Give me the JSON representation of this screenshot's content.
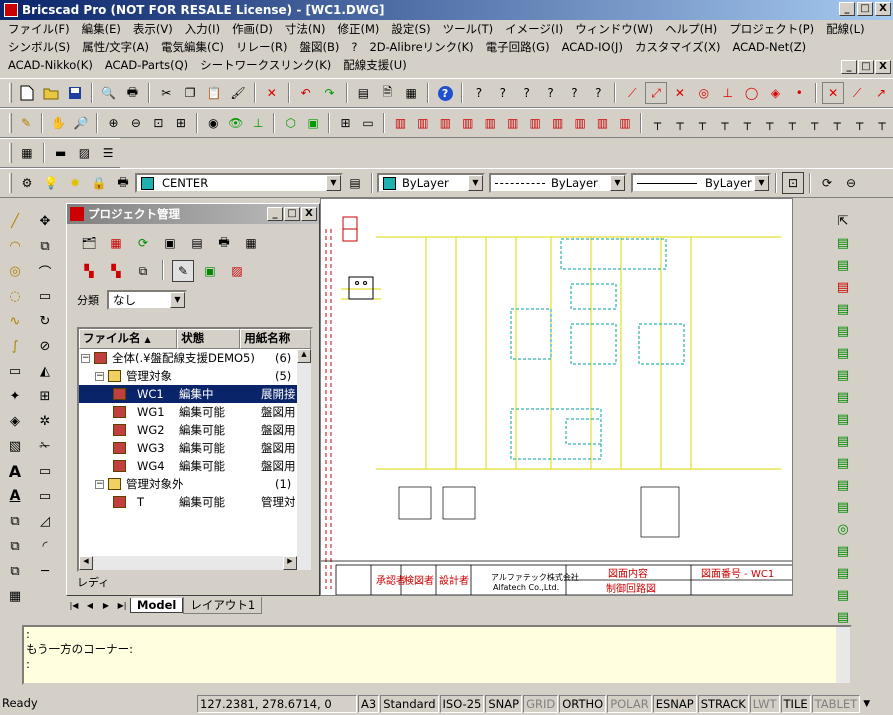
{
  "window": {
    "title": "Bricscad Pro (NOT FOR RESALE License) - [WC1.DWG]",
    "controls": [
      "_",
      "□",
      "X"
    ]
  },
  "menus": {
    "row1": [
      "ファイル(F)",
      "編集(E)",
      "表示(V)",
      "入力(I)",
      "作画(D)",
      "寸法(N)",
      "修正(M)",
      "設定(S)",
      "ツール(T)",
      "イメージ(I)",
      "ウィンドウ(W)",
      "ヘルプ(H)",
      "プロジェクト(P)",
      "配線(L)"
    ],
    "row2": [
      "シンボル(S)",
      "属性/文字(A)",
      "電気編集(C)",
      "リレー(R)",
      "盤図(B)",
      "?",
      "2D-Alibreリンク(K)",
      "電子回路(G)",
      "ACAD-IO(J)",
      "カスタマイズ(X)",
      "ACAD-Net(Z)"
    ],
    "row3": [
      "ACAD-Nikko(K)",
      "ACAD-Parts(Q)",
      "シートワークスリンク(K)",
      "配線支援(U)"
    ]
  },
  "properties": {
    "layer": "CENTER",
    "color": "ByLayer",
    "linetype": "ByLayer",
    "lineweight": "ByLayer",
    "layer_color": "#20b0b0"
  },
  "project": {
    "title": "プロジェクト管理",
    "category_label": "分類",
    "category_value": "なし",
    "columns": [
      "ファイル名",
      "状態",
      "用紙名称"
    ],
    "root": {
      "label": "全体(.¥盤配線支援DEMO5)",
      "count": "(6)"
    },
    "groups": [
      {
        "label": "管理対象",
        "count": "(5)",
        "files": [
          {
            "name": "WC1",
            "status": "編集中",
            "paper": "展開接",
            "selected": true
          },
          {
            "name": "WG1",
            "status": "編集可能",
            "paper": "盤図用"
          },
          {
            "name": "WG2",
            "status": "編集可能",
            "paper": "盤図用"
          },
          {
            "name": "WG3",
            "status": "編集可能",
            "paper": "盤図用"
          },
          {
            "name": "WG4",
            "status": "編集可能",
            "paper": "盤図用"
          }
        ]
      },
      {
        "label": "管理対象外",
        "count": "(1)",
        "files": [
          {
            "name": "T",
            "status": "編集可能",
            "paper": "管理対"
          }
        ]
      }
    ],
    "status_text": "レディ"
  },
  "tabs": {
    "model": "Model",
    "layout1": "レイアウト1"
  },
  "title_block": {
    "company_jp": "アルファテック株式会社",
    "company_en": "Alfatech Co.,Ltd.",
    "drawing_name": "図面内容",
    "drawing_sub": "制御回路図",
    "drawing_no": "図面番号 - WC1",
    "approver": "承認者",
    "checker": "検図者",
    "designer": "設計者"
  },
  "command": {
    "lines": [
      ":",
      "もう一方のコーナー:",
      ":"
    ]
  },
  "statusbar": {
    "ready": "Ready",
    "coords": "127.2381, 278.6714, 0",
    "paper": "A3",
    "textstyle": "Standard",
    "dimstyle": "ISO-25",
    "toggles": [
      {
        "label": "SNAP",
        "on": true
      },
      {
        "label": "GRID",
        "on": false
      },
      {
        "label": "ORTHO",
        "on": true
      },
      {
        "label": "POLAR",
        "on": false
      },
      {
        "label": "ESNAP",
        "on": true
      },
      {
        "label": "STRACK",
        "on": true
      },
      {
        "label": "LWT",
        "on": false
      },
      {
        "label": "TILE",
        "on": true
      },
      {
        "label": "TABLET",
        "on": false
      }
    ]
  },
  "colors": {
    "titlebar_start": "#0a246a",
    "titlebar_end": "#a6caf0",
    "wire_yellow": "#d8d800",
    "component_cyan": "#00a0a0",
    "wire_green": "#00a000",
    "command_bg": "#ffffe0"
  }
}
